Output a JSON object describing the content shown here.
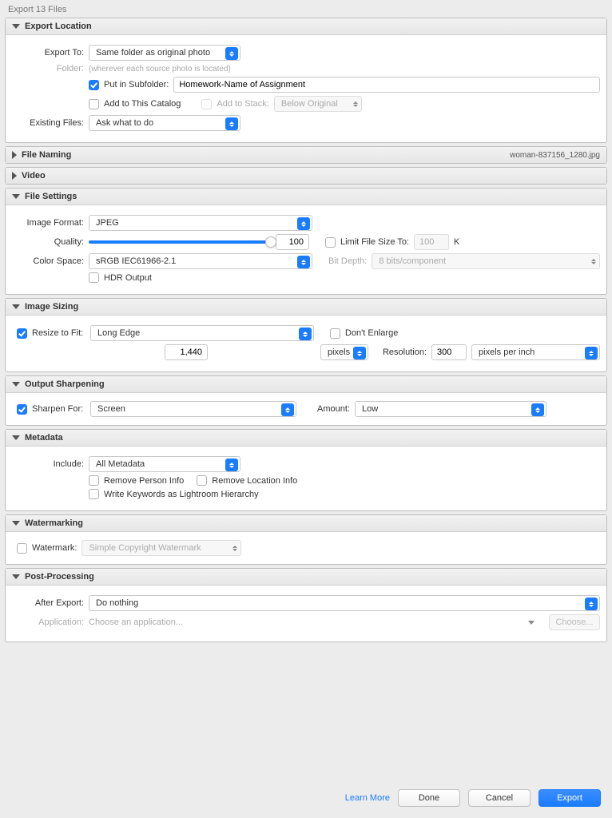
{
  "window_title": "Export 13 Files",
  "sections": {
    "export_location": {
      "title": "Export Location",
      "export_to_label": "Export To:",
      "export_to_value": "Same folder as original photo",
      "folder_label": "Folder:",
      "folder_note": "(wherever each source photo is located)",
      "put_in_subfolder_label": "Put in Subfolder:",
      "subfolder_value": "Homework-Name of Assignment",
      "add_to_catalog_label": "Add to This Catalog",
      "add_to_stack_label": "Add to Stack:",
      "stack_position": "Below Original",
      "existing_files_label": "Existing Files:",
      "existing_files_value": "Ask what to do"
    },
    "file_naming": {
      "title": "File Naming",
      "example": "woman-837156_1280.jpg"
    },
    "video": {
      "title": "Video"
    },
    "file_settings": {
      "title": "File Settings",
      "image_format_label": "Image Format:",
      "image_format_value": "JPEG",
      "quality_label": "Quality:",
      "quality_value": "100",
      "limit_label": "Limit File Size To:",
      "limit_value": "100",
      "limit_unit": "K",
      "color_space_label": "Color Space:",
      "color_space_value": "sRGB IEC61966-2.1",
      "bit_depth_label": "Bit Depth:",
      "bit_depth_value": "8 bits/component",
      "hdr_label": "HDR Output"
    },
    "image_sizing": {
      "title": "Image Sizing",
      "resize_label": "Resize to Fit:",
      "resize_value": "Long Edge",
      "dont_enlarge_label": "Don't Enlarge",
      "dimension_value": "1,440",
      "dimension_unit": "pixels",
      "resolution_label": "Resolution:",
      "resolution_value": "300",
      "resolution_unit": "pixels per inch"
    },
    "output_sharpening": {
      "title": "Output Sharpening",
      "sharpen_label": "Sharpen For:",
      "sharpen_value": "Screen",
      "amount_label": "Amount:",
      "amount_value": "Low"
    },
    "metadata": {
      "title": "Metadata",
      "include_label": "Include:",
      "include_value": "All Metadata",
      "remove_person_label": "Remove Person Info",
      "remove_location_label": "Remove Location Info",
      "keywords_label": "Write Keywords as Lightroom Hierarchy"
    },
    "watermarking": {
      "title": "Watermarking",
      "watermark_label": "Watermark:",
      "watermark_value": "Simple Copyright Watermark"
    },
    "post_processing": {
      "title": "Post-Processing",
      "after_export_label": "After Export:",
      "after_export_value": "Do nothing",
      "application_label": "Application:",
      "application_placeholder": "Choose an application...",
      "choose_btn": "Choose..."
    }
  },
  "footer": {
    "learn_more": "Learn More",
    "done": "Done",
    "cancel": "Cancel",
    "export": "Export"
  }
}
